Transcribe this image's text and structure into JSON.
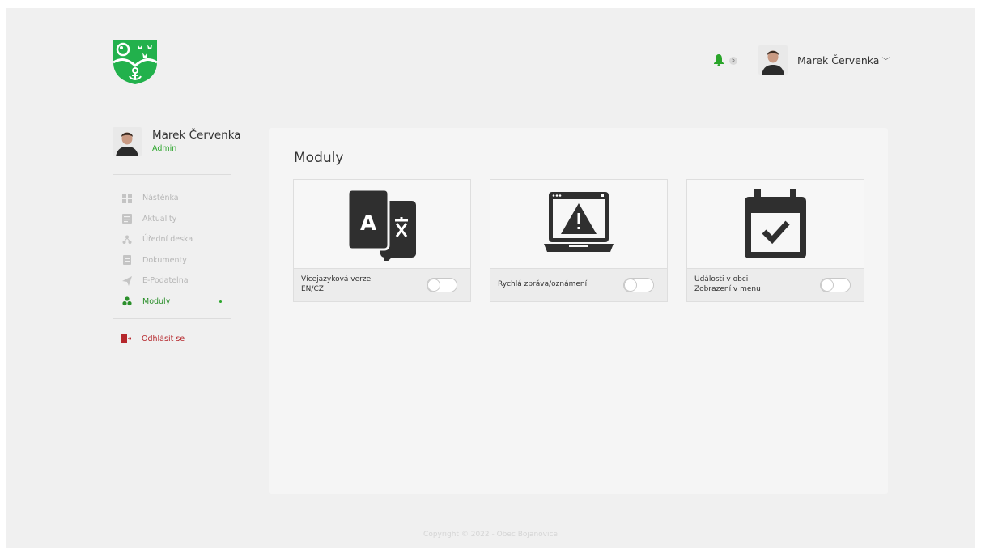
{
  "header": {
    "notifications_count": "5",
    "user_name": "Marek Červenka",
    "chevron": "﹀"
  },
  "sidebar": {
    "user_name": "Marek Červenka",
    "role": "Admin",
    "items": [
      {
        "label": "Nástěnka",
        "icon": "dashboard-icon",
        "active": false
      },
      {
        "label": "Aktuality",
        "icon": "news-icon",
        "active": false
      },
      {
        "label": "Úřední deska",
        "icon": "noticeboard-icon",
        "active": false
      },
      {
        "label": "Dokumenty",
        "icon": "document-icon",
        "active": false
      },
      {
        "label": "E-Podatelna",
        "icon": "send-icon",
        "active": false
      },
      {
        "label": "Moduly",
        "icon": "modules-icon",
        "active": true
      }
    ],
    "logout_label": "Odhlásit se"
  },
  "main": {
    "title": "Moduly",
    "modules": [
      {
        "label": "Vícejazyková verze\nEN/CZ",
        "icon": "translate-icon",
        "enabled": false
      },
      {
        "label": "Rychlá zpráva/oznámení",
        "icon": "warning-screen-icon",
        "enabled": false
      },
      {
        "label": "Události v obci\nZobrazení v menu",
        "icon": "calendar-check-icon",
        "enabled": false
      }
    ]
  },
  "footer": {
    "copyright": "Copyright © 2022 - Obec Bojanovice"
  },
  "colors": {
    "accent": "#2aa52a",
    "logout": "#b5262b",
    "icon_dark": "#2f2f2f"
  }
}
